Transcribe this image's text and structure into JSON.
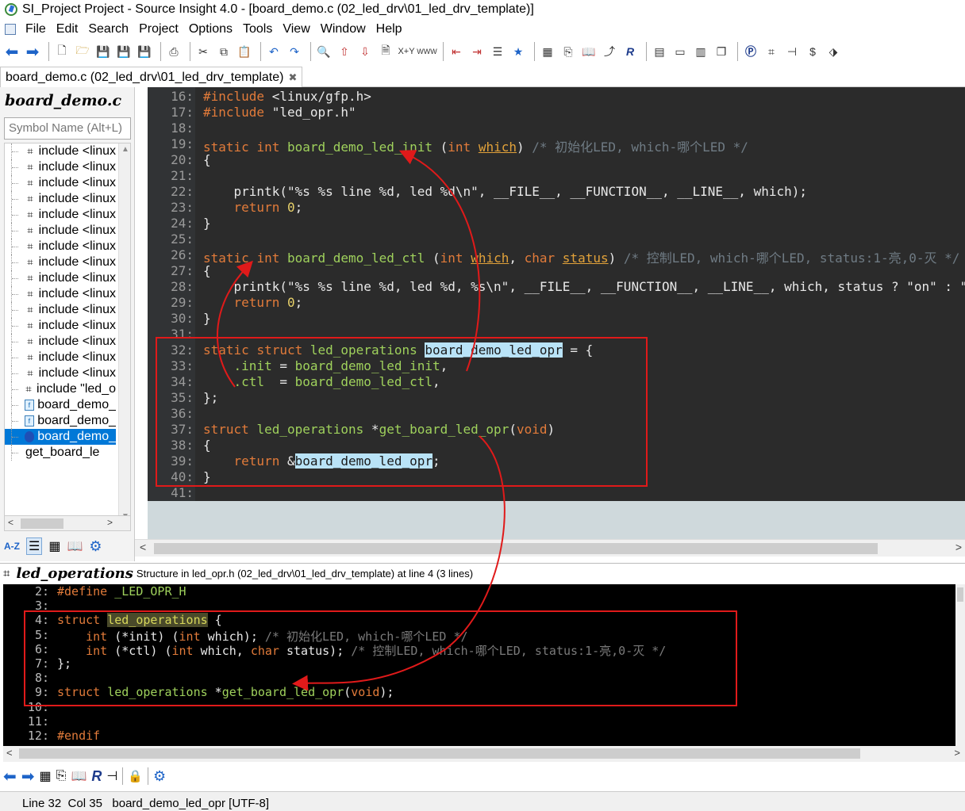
{
  "window": {
    "title": "SI_Project Project - Source Insight 4.0 - [board_demo.c (02_led_drv\\01_led_drv_template)]"
  },
  "menu": [
    "File",
    "Edit",
    "Search",
    "Project",
    "Options",
    "Tools",
    "View",
    "Window",
    "Help"
  ],
  "tab": {
    "label": "board_demo.c (02_led_drv\\01_led_drv_template)",
    "close": "✖"
  },
  "symbol_panel": {
    "title": "board_demo.c",
    "search_placeholder": "Symbol Name (Alt+L)",
    "items": [
      {
        "icon": "include",
        "label": "include <linux"
      },
      {
        "icon": "include",
        "label": "include <linux"
      },
      {
        "icon": "include",
        "label": "include <linux"
      },
      {
        "icon": "include",
        "label": "include <linux"
      },
      {
        "icon": "include",
        "label": "include <linux"
      },
      {
        "icon": "include",
        "label": "include <linux"
      },
      {
        "icon": "include",
        "label": "include <linux"
      },
      {
        "icon": "include",
        "label": "include <linux"
      },
      {
        "icon": "include",
        "label": "include <linux"
      },
      {
        "icon": "include",
        "label": "include <linux"
      },
      {
        "icon": "include",
        "label": "include <linux"
      },
      {
        "icon": "include",
        "label": "include <linux"
      },
      {
        "icon": "include",
        "label": "include <linux"
      },
      {
        "icon": "include",
        "label": "include <linux"
      },
      {
        "icon": "include",
        "label": "include <linux"
      },
      {
        "icon": "include",
        "label": "include \"led_o"
      },
      {
        "icon": "function",
        "label": "board_demo_"
      },
      {
        "icon": "function",
        "label": "board_demo_"
      },
      {
        "icon": "struct",
        "label": "board_demo_"
      },
      {
        "icon": "none",
        "label": "get_board_le"
      }
    ]
  },
  "editor": {
    "lines": [
      {
        "n": "16:",
        "html": "<span class='pp'>#include</span> <span class='inc'>&lt;linux/gfp.h&gt;</span>"
      },
      {
        "n": "17:",
        "html": "<span class='pp'>#include</span> <span class='inc'>\"led_opr.h\"</span>"
      },
      {
        "n": "18:",
        "html": ""
      },
      {
        "n": "19:",
        "html": "<span class='kw'>static</span> <span class='ty'>int</span> <span class='fn'>board_demo_led_init</span> (<span class='ty'>int</span> <span class='ul'>which</span>) <span class='cm'>/* 初始化LED, which-哪个LED */</span>"
      },
      {
        "n": "20:",
        "html": "{"
      },
      {
        "n": "21:",
        "html": ""
      },
      {
        "n": "22:",
        "html": "    printk(\"%s %s line %d, led %d\\n\", __FILE__, __FUNCTION__, __LINE__, which);"
      },
      {
        "n": "23:",
        "html": "    <span class='kw'>return</span> <span class='num'>0</span>;"
      },
      {
        "n": "24:",
        "html": "}"
      },
      {
        "n": "25:",
        "html": ""
      },
      {
        "n": "26:",
        "html": "<span class='kw'>static</span> <span class='ty'>int</span> <span class='fn'>board_demo_led_ctl</span> (<span class='ty'>int</span> <span class='ul'>which</span>, <span class='ty'>char</span> <span class='ul'>status</span>) <span class='cm'>/* 控制LED, which-哪个LED, status:1-亮,0-灭 */</span>"
      },
      {
        "n": "27:",
        "html": "{"
      },
      {
        "n": "28:",
        "html": "    printk(\"%s %s line %d, led %d, %s\\n\", __FILE__, __FUNCTION__, __LINE__, which, status ? \"on\" : \"off\");"
      },
      {
        "n": "29:",
        "html": "    <span class='kw'>return</span> <span class='num'>0</span>;"
      },
      {
        "n": "30:",
        "html": "}"
      },
      {
        "n": "31:",
        "html": ""
      },
      {
        "n": "32:",
        "html": "<span class='kw'>static</span> <span class='kw'>struct</span> <span class='fn'>led_operations</span> <span class='hl'>board_demo_led_opr</span> = {"
      },
      {
        "n": "33:",
        "html": "    <span class='fn'>.init</span> = <span class='fn'>board_demo_led_init</span>,"
      },
      {
        "n": "34:",
        "html": "    <span class='fn'>.ctl</span>  = <span class='fn'>board_demo_led_ctl</span>,"
      },
      {
        "n": "35:",
        "html": "};"
      },
      {
        "n": "36:",
        "html": ""
      },
      {
        "n": "37:",
        "html": "<span class='kw'>struct</span> <span class='fn'>led_operations</span> *<span class='fn'>get_board_led_opr</span>(<span class='ty'>void</span>)"
      },
      {
        "n": "38:",
        "html": "{"
      },
      {
        "n": "39:",
        "html": "    <span class='kw'>return</span> &amp;<span class='hl'>board_demo_led_opr</span>;"
      },
      {
        "n": "40:",
        "html": "}"
      },
      {
        "n": "41:",
        "html": ""
      }
    ]
  },
  "context": {
    "name": "led_operations",
    "desc": "Structure in led_opr.h (02_led_drv\\01_led_drv_template) at line 4 (3 lines)",
    "lines": [
      {
        "n": "2:",
        "html": "<span class='ck'>#define</span> <span class='cf'>_LED_OPR_H</span>"
      },
      {
        "n": "3:",
        "html": ""
      },
      {
        "n": "4:",
        "html": "<span class='ck'>struct</span> <span class='chl'>led_operations</span> {"
      },
      {
        "n": "5:",
        "html": "    <span class='ck'>int</span> (*init) (<span class='ck'>int</span> which); <span class='cc'>/* 初始化LED, which-哪个LED */</span>"
      },
      {
        "n": "6:",
        "html": "    <span class='ck'>int</span> (*ctl) (<span class='ck'>int</span> which, <span class='ck'>char</span> status); <span class='cc'>/* 控制LED, which-哪个LED, status:1-亮,0-灭 */</span>"
      },
      {
        "n": "7:",
        "html": "};"
      },
      {
        "n": "8:",
        "html": ""
      },
      {
        "n": "9:",
        "html": "<span class='ck'>struct</span> <span class='cf'>led_operations</span> *<span class='cf'>get_board_led_opr</span>(<span class='ck'>void</span>);"
      },
      {
        "n": "10:",
        "html": ""
      },
      {
        "n": "11:",
        "html": ""
      },
      {
        "n": "12:",
        "html": "<span class='ck'>#endif</span>"
      }
    ]
  },
  "status": "Line 32  Col 35   board_demo_led_opr [UTF-8]",
  "colors": {
    "annotation_red": "#e01a1a",
    "editor_bg": "#2b2b2b",
    "keyword": "#e27b3a",
    "function": "#9fd15c",
    "selection": "#0078d7"
  }
}
